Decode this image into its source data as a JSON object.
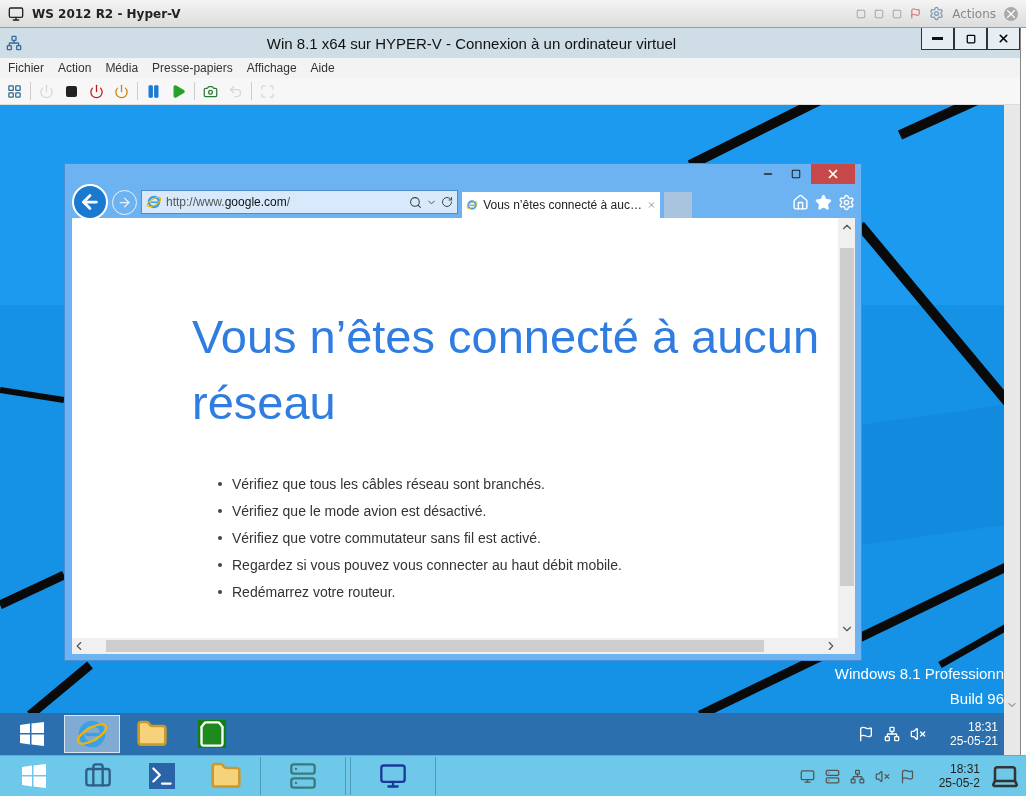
{
  "host_window": {
    "title": "WS 2012 R2 - Hyper-V",
    "actions_label": "Actions"
  },
  "vm_window": {
    "title": "Win 8.1 x64 sur HYPER-V - Connexion à un ordinateur virtuel",
    "menu": [
      "Fichier",
      "Action",
      "Média",
      "Presse-papiers",
      "Affichage",
      "Aide"
    ],
    "toolbar": [
      {
        "kind": "ctrl-alt-del",
        "disabled": false
      },
      {
        "kind": "separator"
      },
      {
        "kind": "start",
        "disabled": true
      },
      {
        "kind": "turn-off",
        "disabled": false
      },
      {
        "kind": "shut-down",
        "disabled": false
      },
      {
        "kind": "save",
        "disabled": false
      },
      {
        "kind": "separator"
      },
      {
        "kind": "pause",
        "disabled": false
      },
      {
        "kind": "resume",
        "disabled": false
      },
      {
        "kind": "separator"
      },
      {
        "kind": "checkpoint",
        "disabled": false
      },
      {
        "kind": "revert",
        "disabled": true
      },
      {
        "kind": "separator"
      },
      {
        "kind": "enhanced",
        "disabled": true
      }
    ]
  },
  "browser": {
    "address": "http://www.**google.com**/",
    "tabs": [
      {
        "title": "Vous n’êtes connecté à auc…",
        "selected": true
      }
    ],
    "page": {
      "heading": "Vous n’êtes connecté à aucun réseau",
      "tips": [
        "Vérifiez que tous les câbles réseau sont branchés.",
        "Vérifiez que le mode avion est désactivé.",
        "Vérifiez que votre commutateur sans fil est activé.",
        "Regardez si vous pouvez vous connecter au haut débit mobile.",
        "Redémarrez votre routeur."
      ]
    }
  },
  "desktop": {
    "edition_lines": [
      "Windows 8.1 Professionn",
      "Build 96"
    ]
  },
  "guest_taskbar": {
    "apps": [
      {
        "kind": "start",
        "selected": false
      },
      {
        "kind": "browser",
        "selected": true
      },
      {
        "kind": "folder",
        "selected": false
      },
      {
        "kind": "store",
        "selected": false
      }
    ],
    "time": "18:31",
    "date": "25-05-21"
  },
  "host_taskbar": {
    "apps": [
      {
        "kind": "start",
        "open": false
      },
      {
        "kind": "server-manager",
        "open": false
      },
      {
        "kind": "powershell",
        "open": false
      },
      {
        "kind": "folder",
        "open": false
      },
      {
        "kind": "servers",
        "open": true
      },
      {
        "kind": "vm-connect",
        "open": true
      }
    ],
    "time": "18:31",
    "date": "25-05-2"
  }
}
